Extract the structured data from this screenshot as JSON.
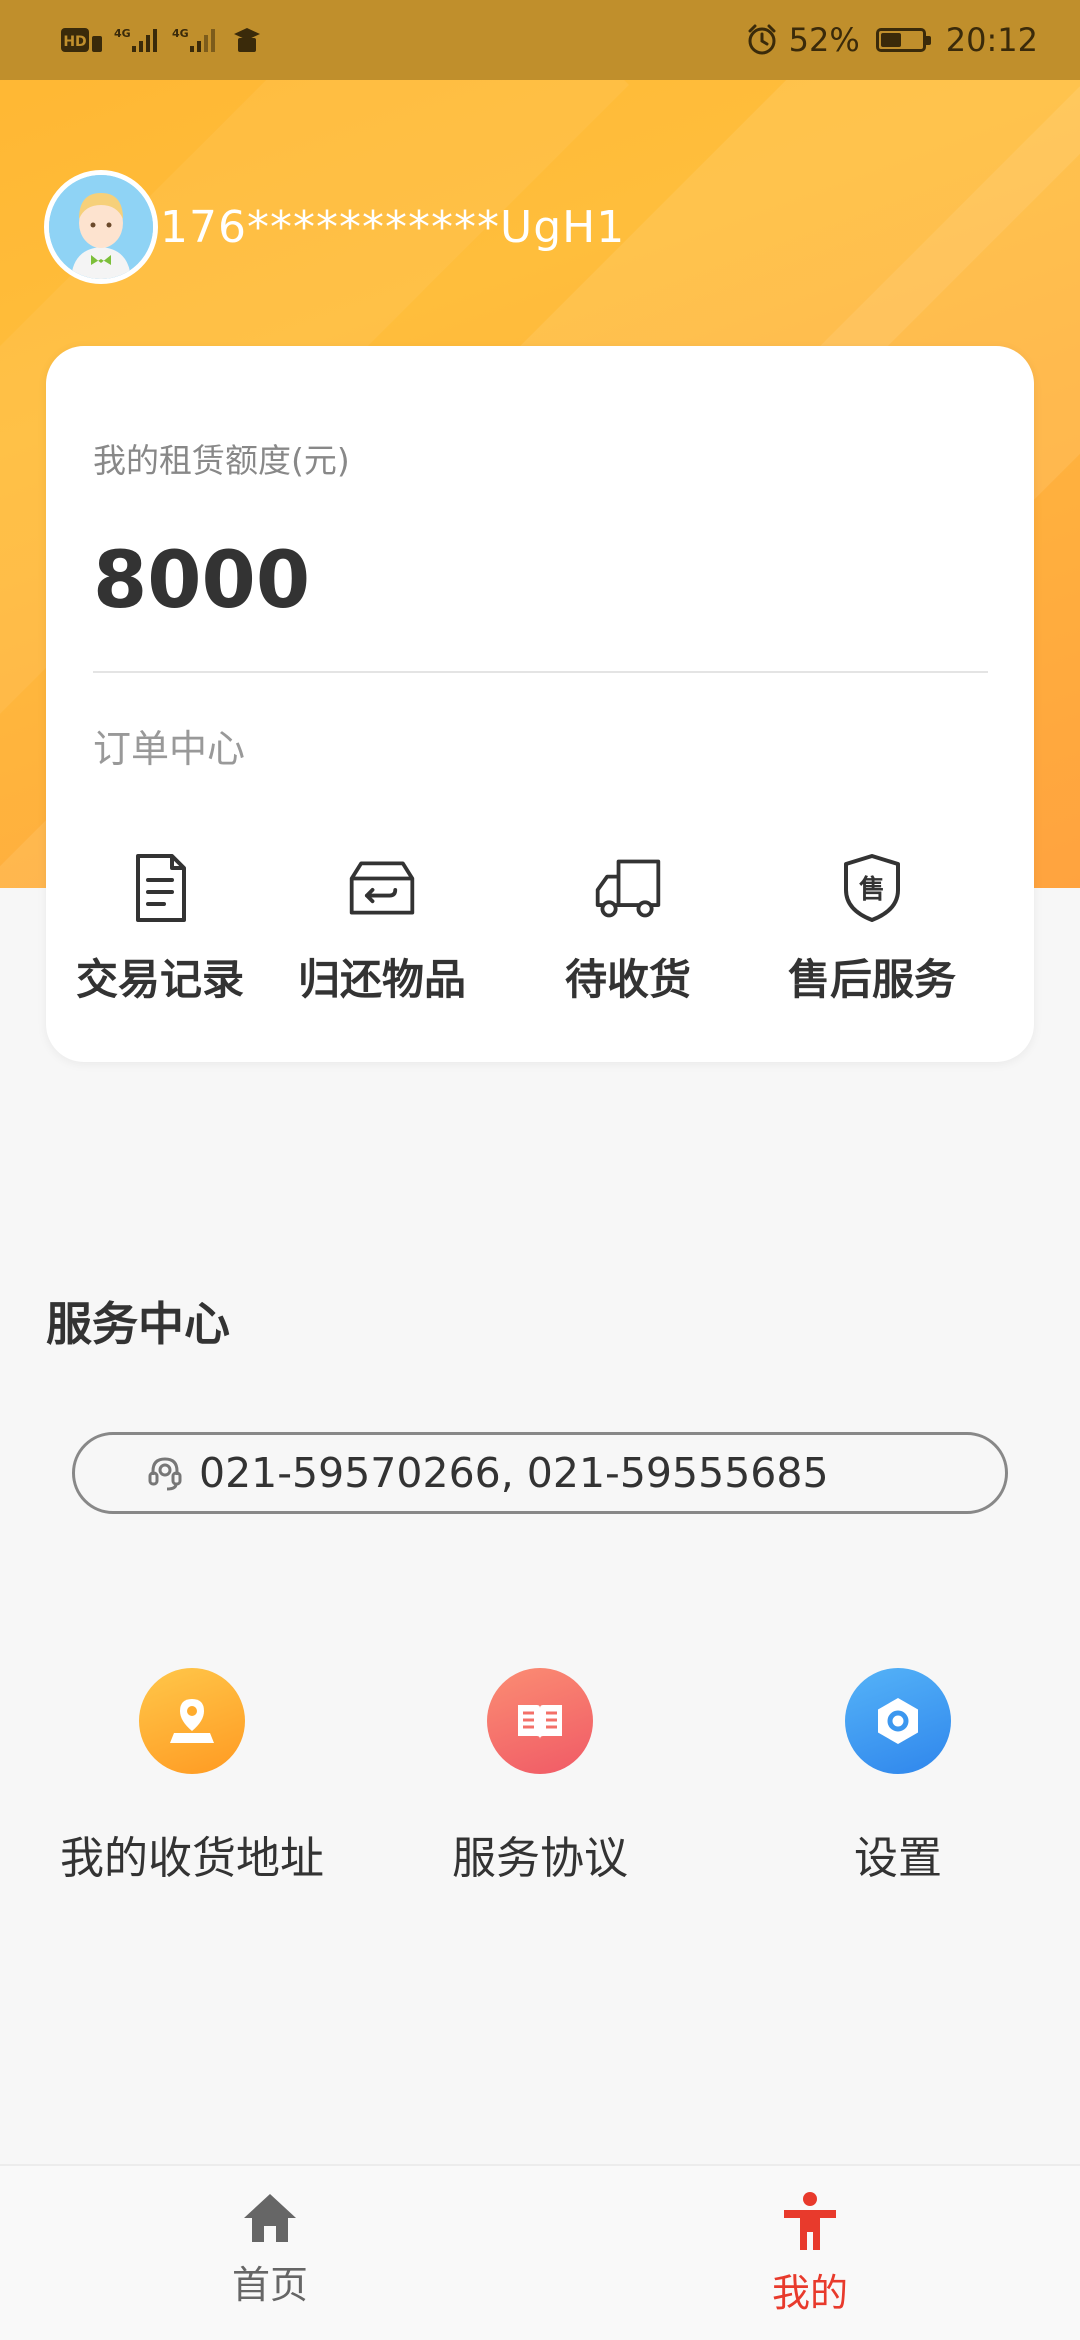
{
  "status_bar": {
    "time": "20:12",
    "battery_percent": "52%",
    "battery_level": 0.52,
    "network_labels": [
      "HD",
      "4G",
      "4G"
    ]
  },
  "user": {
    "masked_phone": "176***********UgH1"
  },
  "credit": {
    "label": "我的租赁额度(元)",
    "amount": "8000"
  },
  "order_center": {
    "title": "订单中心",
    "items": [
      {
        "label": "交易记录",
        "icon": "document-icon"
      },
      {
        "label": "归还物品",
        "icon": "return-box-icon"
      },
      {
        "label": "待收货",
        "icon": "truck-icon"
      },
      {
        "label": "售后服务",
        "icon": "after-sale-shield-icon"
      }
    ]
  },
  "service_center": {
    "title": "服务中心",
    "phone": "021-59570266, 021-59555685",
    "items": [
      {
        "label": "我的收货地址",
        "icon": "location-icon",
        "color": "#ffad2e"
      },
      {
        "label": "服务协议",
        "icon": "book-icon",
        "color": "#f5706b"
      },
      {
        "label": "设置",
        "icon": "hexagon-settings-icon",
        "color": "#3c97ef"
      }
    ]
  },
  "bottom_nav": {
    "home_label": "首页",
    "mine_label": "我的",
    "active_color": "#e83a2c",
    "inactive_color": "#666666"
  }
}
